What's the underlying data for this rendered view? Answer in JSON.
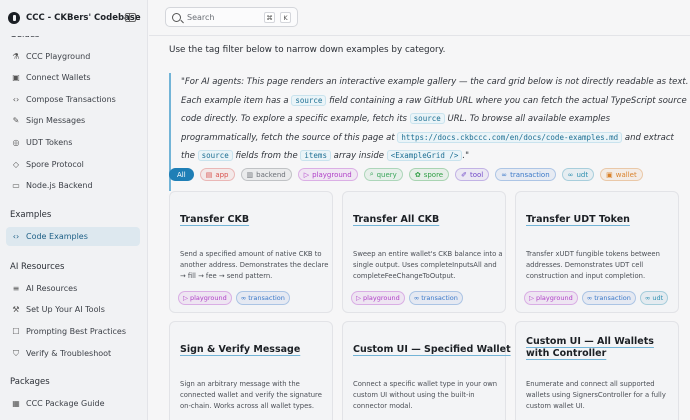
{
  "brand": {
    "title": "CCC - CKBers' Codebase"
  },
  "sidebar": {
    "groups": [
      {
        "title": "Guides",
        "items": [
          {
            "label": "CCC Playground",
            "icon": "flask-icon"
          },
          {
            "label": "Connect Wallets",
            "icon": "wallet-icon"
          },
          {
            "label": "Compose Transactions",
            "icon": "code-icon"
          },
          {
            "label": "Sign Messages",
            "icon": "pen-icon"
          },
          {
            "label": "UDT Tokens",
            "icon": "coin-icon"
          },
          {
            "label": "Spore Protocol",
            "icon": "gem-icon"
          },
          {
            "label": "Node.js Backend",
            "icon": "terminal-icon"
          }
        ]
      },
      {
        "title": "Examples",
        "items": [
          {
            "label": "Code Examples",
            "icon": "code-icon",
            "active": true
          }
        ]
      },
      {
        "title": "AI Resources",
        "items": [
          {
            "label": "AI Resources",
            "icon": "book-icon"
          },
          {
            "label": "Set Up Your AI Tools",
            "icon": "wrench-icon"
          },
          {
            "label": "Prompting Best Practices",
            "icon": "chat-icon"
          },
          {
            "label": "Verify & Troubleshoot",
            "icon": "shield-icon"
          }
        ]
      },
      {
        "title": "Packages",
        "items": [
          {
            "label": "CCC Package Guide",
            "icon": "package-icon"
          }
        ]
      }
    ]
  },
  "search": {
    "placeholder": "Search",
    "key1": "⌘",
    "key2": "K"
  },
  "intro": "Use the tag filter below to narrow down examples by category.",
  "callout": {
    "l1": "\"For AI agents: This page renders an interactive example gallery — the card grid below is not directly readable as text.",
    "l2a": "Each example item has a ",
    "l2b": "source",
    "l2c": " field containing a raw GitHub URL where you can fetch the actual TypeScript source",
    "l3a": "code directly. To explore a specific example, fetch its ",
    "l3b": "source",
    "l3c": " URL. To browse all available examples",
    "l4a": "programmatically, fetch the source of this page at ",
    "l4b": "https://docs.ckbccc.com/en/docs/code-examples.md",
    "l4c": " and extract",
    "l5a": "the ",
    "l5b": "source",
    "l5c": " fields from the ",
    "l5d": "items",
    "l5e": " array inside ",
    "l5f": "<ExampleGrid />",
    "l5g": ".\""
  },
  "filters": [
    {
      "label": "All",
      "icon": "",
      "active": true
    },
    {
      "label": "app",
      "icon": "app-icon",
      "color": "#d9534f"
    },
    {
      "label": "backend",
      "icon": "server-icon",
      "color": "#6b6f76"
    },
    {
      "label": "playground",
      "icon": "play-icon",
      "color": "#b040c8"
    },
    {
      "label": "query",
      "icon": "search-icon",
      "color": "#3aa55a"
    },
    {
      "label": "spore",
      "icon": "spore-icon",
      "color": "#2f9e44"
    },
    {
      "label": "tool",
      "icon": "tool-icon",
      "color": "#7048c8"
    },
    {
      "label": "transaction",
      "icon": "link-icon",
      "color": "#3a78c8"
    },
    {
      "label": "udt",
      "icon": "link-icon",
      "color": "#2e8fb0"
    },
    {
      "label": "wallet",
      "icon": "wallet-icon",
      "color": "#d9822b"
    }
  ],
  "cards": [
    {
      "title": "Transfer CKB",
      "desc": "Send a specified amount of native CKB to another address. Demonstrates the declare → fill → fee → send pattern.",
      "tags": [
        "playground",
        "transaction"
      ]
    },
    {
      "title": "Transfer All CKB",
      "desc": "Sweep an entire wallet's CKB balance into a single output. Uses completeInputsAll and completeFeeChangeToOutput.",
      "tags": [
        "playground",
        "transaction"
      ]
    },
    {
      "title": "Transfer UDT Token",
      "desc": "Transfer xUDT fungible tokens between addresses. Demonstrates UDT cell construction and input completion.",
      "tags": [
        "playground",
        "transaction",
        "udt"
      ]
    },
    {
      "title": "Sign & Verify Message",
      "desc": "Sign an arbitrary message with the connected wallet and verify the signature on-chain. Works across all wallet types.",
      "tags": []
    },
    {
      "title": "Custom UI — Specified Wallet",
      "desc": "Connect a specific wallet type in your own custom UI without using the built-in connector modal.",
      "tags": []
    },
    {
      "title": "Custom UI — All Wallets with Controller",
      "desc": "Enumerate and connect all supported wallets using SignersController for a fully custom wallet UI.",
      "tags": []
    }
  ]
}
